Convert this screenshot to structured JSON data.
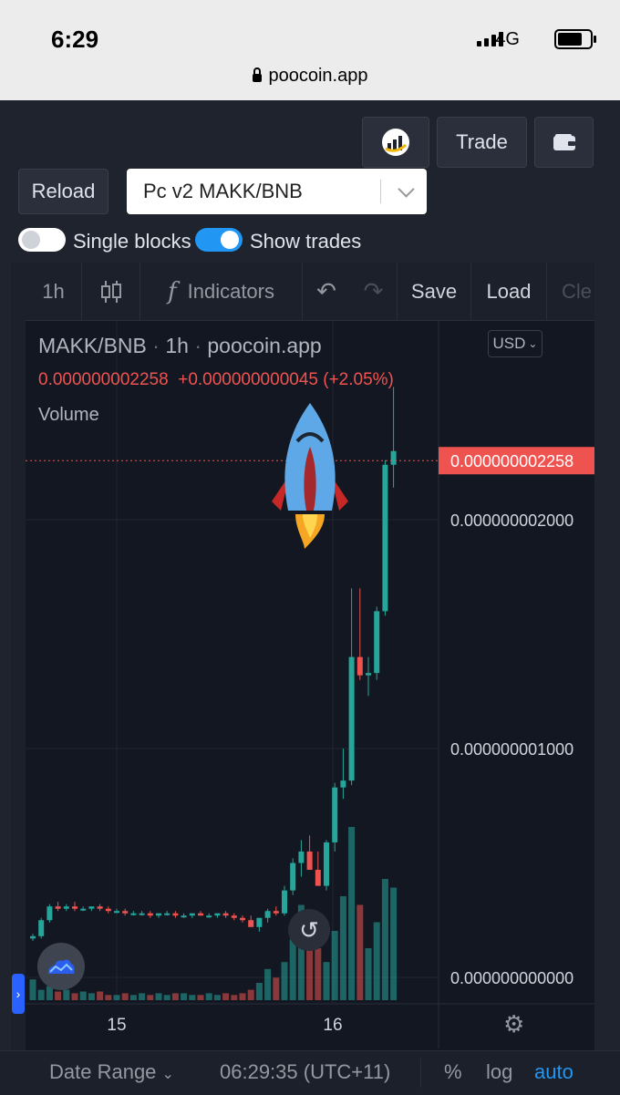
{
  "status": {
    "time": "6:29",
    "network": "4G",
    "url": "poocoin.app"
  },
  "controls": {
    "trade_label": "Trade",
    "reload_label": "Reload",
    "pair_select": "Pc v2 MAKK/BNB",
    "single_blocks_label": "Single blocks",
    "show_trades_label": "Show trades",
    "single_blocks_on": false,
    "show_trades_on": true
  },
  "toolbar": {
    "interval": "1h",
    "indicators_label": "Indicators",
    "save_label": "Save",
    "load_label": "Load",
    "clear_label": "Cle"
  },
  "legend": {
    "title": "MAKK/BNB",
    "sep": "·",
    "interval": "1h",
    "source": "poocoin.app",
    "price": "0.000000002258",
    "change": "+0.000000000045 (+2.05%)",
    "volume_label": "Volume"
  },
  "currency": "USD",
  "colors": {
    "up": "#26a69a",
    "down": "#ef5350",
    "accent": "#2196f3"
  },
  "chart_data": {
    "type": "candlestick",
    "x_labels": [
      "15",
      "16"
    ],
    "y_ticks": [
      "0.000000002000",
      "0.000000001000",
      "0.000000000000"
    ],
    "y_tick_values": [
      2.0,
      1.0,
      0.0
    ],
    "value_scale": "1e-9",
    "last_price_label": "0.000000002258",
    "last_price": 2.258,
    "candles": [
      {
        "o": 0.17,
        "h": 0.19,
        "l": 0.16,
        "c": 0.18
      },
      {
        "o": 0.18,
        "h": 0.26,
        "l": 0.17,
        "c": 0.25
      },
      {
        "o": 0.25,
        "h": 0.32,
        "l": 0.24,
        "c": 0.31
      },
      {
        "o": 0.31,
        "h": 0.33,
        "l": 0.29,
        "c": 0.3
      },
      {
        "o": 0.3,
        "h": 0.32,
        "l": 0.29,
        "c": 0.31
      },
      {
        "o": 0.31,
        "h": 0.33,
        "l": 0.29,
        "c": 0.3
      },
      {
        "o": 0.3,
        "h": 0.31,
        "l": 0.29,
        "c": 0.3
      },
      {
        "o": 0.3,
        "h": 0.31,
        "l": 0.29,
        "c": 0.31
      },
      {
        "o": 0.31,
        "h": 0.32,
        "l": 0.29,
        "c": 0.3
      },
      {
        "o": 0.3,
        "h": 0.31,
        "l": 0.28,
        "c": 0.29
      },
      {
        "o": 0.29,
        "h": 0.3,
        "l": 0.28,
        "c": 0.29
      },
      {
        "o": 0.29,
        "h": 0.3,
        "l": 0.27,
        "c": 0.28
      },
      {
        "o": 0.28,
        "h": 0.29,
        "l": 0.27,
        "c": 0.28
      },
      {
        "o": 0.28,
        "h": 0.29,
        "l": 0.27,
        "c": 0.28
      },
      {
        "o": 0.28,
        "h": 0.29,
        "l": 0.26,
        "c": 0.27
      },
      {
        "o": 0.27,
        "h": 0.28,
        "l": 0.26,
        "c": 0.28
      },
      {
        "o": 0.28,
        "h": 0.29,
        "l": 0.27,
        "c": 0.28
      },
      {
        "o": 0.28,
        "h": 0.29,
        "l": 0.26,
        "c": 0.27
      },
      {
        "o": 0.27,
        "h": 0.28,
        "l": 0.26,
        "c": 0.27
      },
      {
        "o": 0.27,
        "h": 0.28,
        "l": 0.26,
        "c": 0.28
      },
      {
        "o": 0.28,
        "h": 0.29,
        "l": 0.27,
        "c": 0.27
      },
      {
        "o": 0.27,
        "h": 0.28,
        "l": 0.26,
        "c": 0.27
      },
      {
        "o": 0.27,
        "h": 0.28,
        "l": 0.26,
        "c": 0.28
      },
      {
        "o": 0.28,
        "h": 0.29,
        "l": 0.26,
        "c": 0.27
      },
      {
        "o": 0.27,
        "h": 0.28,
        "l": 0.25,
        "c": 0.26
      },
      {
        "o": 0.26,
        "h": 0.27,
        "l": 0.24,
        "c": 0.25
      },
      {
        "o": 0.25,
        "h": 0.27,
        "l": 0.24,
        "c": 0.22
      },
      {
        "o": 0.22,
        "h": 0.26,
        "l": 0.2,
        "c": 0.26
      },
      {
        "o": 0.26,
        "h": 0.3,
        "l": 0.24,
        "c": 0.29
      },
      {
        "o": 0.29,
        "h": 0.31,
        "l": 0.27,
        "c": 0.28
      },
      {
        "o": 0.28,
        "h": 0.4,
        "l": 0.27,
        "c": 0.38
      },
      {
        "o": 0.38,
        "h": 0.52,
        "l": 0.36,
        "c": 0.5
      },
      {
        "o": 0.5,
        "h": 0.6,
        "l": 0.44,
        "c": 0.55
      },
      {
        "o": 0.55,
        "h": 0.62,
        "l": 0.47,
        "c": 0.47
      },
      {
        "o": 0.47,
        "h": 0.55,
        "l": 0.4,
        "c": 0.4
      },
      {
        "o": 0.4,
        "h": 0.6,
        "l": 0.38,
        "c": 0.59
      },
      {
        "o": 0.59,
        "h": 0.85,
        "l": 0.55,
        "c": 0.83
      },
      {
        "o": 0.83,
        "h": 1.0,
        "l": 0.78,
        "c": 0.86
      },
      {
        "o": 0.86,
        "h": 1.7,
        "l": 0.84,
        "c": 1.4
      },
      {
        "o": 1.4,
        "h": 1.7,
        "l": 1.3,
        "c": 1.32
      },
      {
        "o": 1.32,
        "h": 1.4,
        "l": 1.23,
        "c": 1.33
      },
      {
        "o": 1.33,
        "h": 1.62,
        "l": 1.3,
        "c": 1.6
      },
      {
        "o": 1.6,
        "h": 2.26,
        "l": 1.58,
        "c": 2.24
      },
      {
        "o": 2.24,
        "h": 2.58,
        "l": 2.14,
        "c": 2.3
      }
    ],
    "volume": [
      0.12,
      0.06,
      0.08,
      0.05,
      0.06,
      0.04,
      0.05,
      0.04,
      0.05,
      0.03,
      0.03,
      0.04,
      0.03,
      0.04,
      0.03,
      0.04,
      0.03,
      0.04,
      0.04,
      0.03,
      0.03,
      0.04,
      0.03,
      0.04,
      0.03,
      0.04,
      0.06,
      0.1,
      0.18,
      0.13,
      0.22,
      0.35,
      0.55,
      0.4,
      0.3,
      0.22,
      0.4,
      0.6,
      1.0,
      0.55,
      0.3,
      0.45,
      0.7,
      0.65
    ]
  }
}
